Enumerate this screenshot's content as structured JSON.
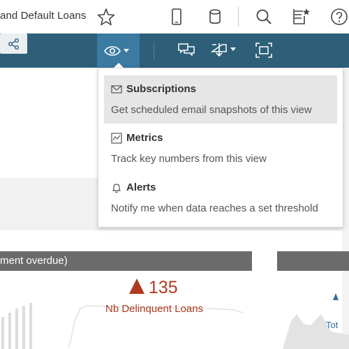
{
  "header": {
    "title": "and Default Loans",
    "icons": [
      "star-icon",
      "device-icon",
      "database-icon",
      "search-icon",
      "notes-icon",
      "help-icon"
    ]
  },
  "toolbar": {
    "icons": [
      "eye-icon",
      "comments-icon",
      "download-icon",
      "fullscreen-icon",
      "share-icon"
    ],
    "colors": {
      "bar": "#2e5f79",
      "active": "#3b7aa1"
    }
  },
  "watch_menu": {
    "items": [
      {
        "icon": "email-icon",
        "title": "Subscriptions",
        "description": "Get scheduled email snapshots of this view"
      },
      {
        "icon": "metrics-icon",
        "title": "Metrics",
        "description": "Track key numbers from this view"
      },
      {
        "icon": "bell-icon",
        "title": "Alerts",
        "description": "Notify me when data reaches a set threshold"
      }
    ]
  },
  "dashboard": {
    "panel_title": "ment overdue)",
    "kpi_value": "135",
    "kpi_label": "Nb Delinquent Loans",
    "right_label": "Tot",
    "colors": {
      "kpi": "#b03a1e",
      "header": "#6b6b6b"
    }
  }
}
